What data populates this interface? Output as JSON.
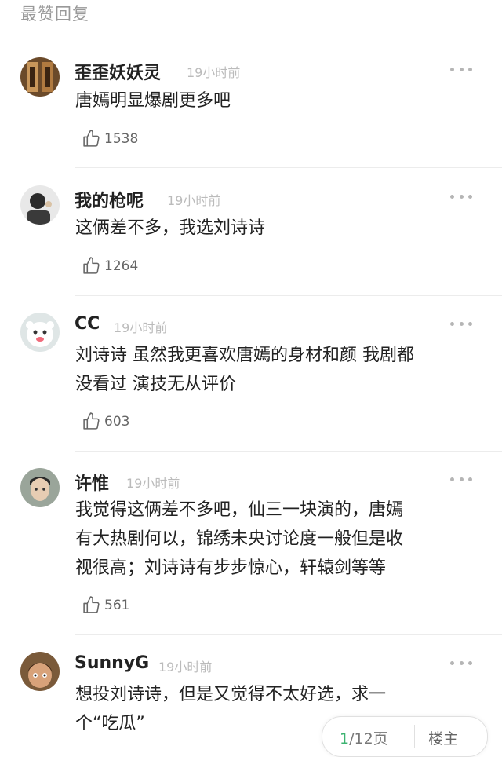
{
  "section_title": "最赞回复",
  "comments": [
    {
      "username": "歪歪妖妖灵",
      "time": "19小时前",
      "text_lines": [
        "唐嫣明显爆剧更多吧"
      ],
      "likes": "1538"
    },
    {
      "username": "我的枪呢",
      "time": "19小时前",
      "text_lines": [
        "这俩差不多，我选刘诗诗"
      ],
      "likes": "1264"
    },
    {
      "username": "CC",
      "time": "19小时前",
      "text_lines": [
        "刘诗诗 虽然我更喜欢唐嫣的身材和颜 我剧都",
        "没看过 演技无从评价"
      ],
      "likes": "603"
    },
    {
      "username": "许惟",
      "time": "19小时前",
      "text_lines": [
        "我觉得这俩差不多吧，仙三一块演的，唐嫣",
        "有大热剧何以，锦绣未央讨论度一般但是收",
        "视很高；刘诗诗有步步惊心，轩辕剑等等"
      ],
      "likes": "561"
    },
    {
      "username": "SunnyG",
      "time": "19小时前",
      "text_lines": [
        "想投刘诗诗，但是又觉得不太好选，求一",
        "个“吃瓜”"
      ],
      "likes": ""
    }
  ],
  "pager": {
    "current": "1",
    "total": "/12页",
    "owner_label": "楼主"
  },
  "icons": {
    "like": "thumbs-up-icon",
    "more": "more-dots-icon"
  },
  "colors": {
    "accent_green": "#3cb371",
    "muted_gray": "#bbbbbb"
  }
}
